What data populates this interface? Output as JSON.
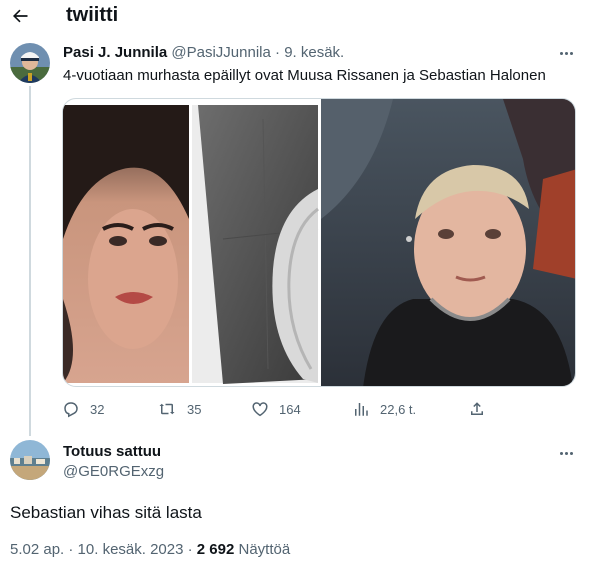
{
  "header": {
    "title": "twiitti"
  },
  "tweet1": {
    "name": "Pasi J. Junnila",
    "handle": "@PasiJJunnila",
    "separator": "·",
    "time": "9. kesäk.",
    "text": "4-vuotiaan murhasta epäillyt ovat Muusa Rissanen ja Sebastian Halonen",
    "stats": {
      "replies": "32",
      "retweets": "35",
      "likes": "164",
      "views": "22,6 t."
    }
  },
  "tweet2": {
    "name": "Totuus sattuu",
    "handle": "@GE0RGExzg",
    "text": "Sebastian vihas sitä lasta",
    "meta_time": "5.02 ap. · 10. kesäk. 2023 · ",
    "meta_views_count": "2 692",
    "meta_views_label": " Näyttöä"
  },
  "icons": {
    "back": "arrow-left-icon",
    "more": "more-dots-icon",
    "reply": "reply-icon",
    "retweet": "retweet-icon",
    "like": "heart-icon",
    "views": "views-bar-icon",
    "share": "share-icon"
  },
  "colors": {
    "text": "#0f1419",
    "muted": "#536471",
    "border": "#cfd9de"
  }
}
